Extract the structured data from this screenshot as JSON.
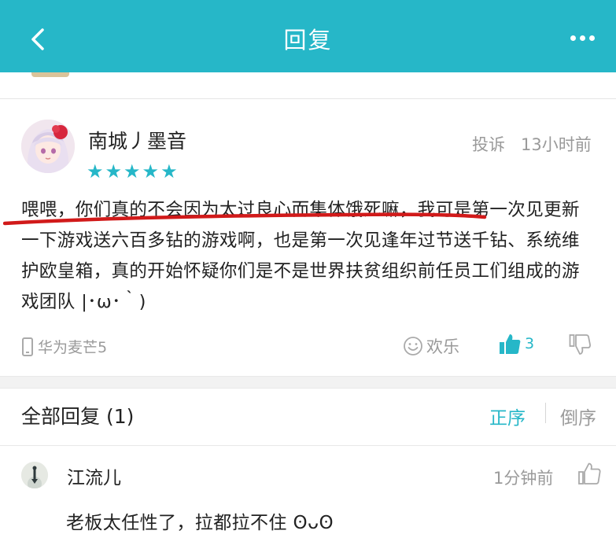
{
  "header": {
    "title": "回复"
  },
  "review": {
    "username": "南城丿墨音",
    "rating": 5,
    "report_label": "投诉",
    "time": "13小时前",
    "content": "喂喂，你们真的不会因为太过良心而集体饿死嘛，我可是第一次见更新一下游戏送六百多钻的游戏啊，也是第一次见逢年过节送千钻、系统维护欧皇箱，真的开始怀疑你们是不是世界扶贫组织前任员工们组成的游戏团队 |･ω･｀)",
    "device": "华为麦芒5",
    "funny_label": "欢乐",
    "like_count": "3"
  },
  "replies": {
    "title": "全部回复 (1)",
    "order_asc": "正序",
    "order_desc": "倒序",
    "items": [
      {
        "username": "江流儿",
        "time": "1分钟前",
        "content": "老板太任性了，拉都拉不住 ʘᴗʘ"
      }
    ]
  },
  "colors": {
    "accent": "#26b7c8",
    "annotation": "#d11a1a",
    "muted": "#9a9a9a"
  },
  "icons": [
    "back-arrow-icon",
    "more-dots-icon",
    "star-icon",
    "phone-icon",
    "smile-icon",
    "thumbs-up-icon",
    "thumbs-down-icon"
  ]
}
